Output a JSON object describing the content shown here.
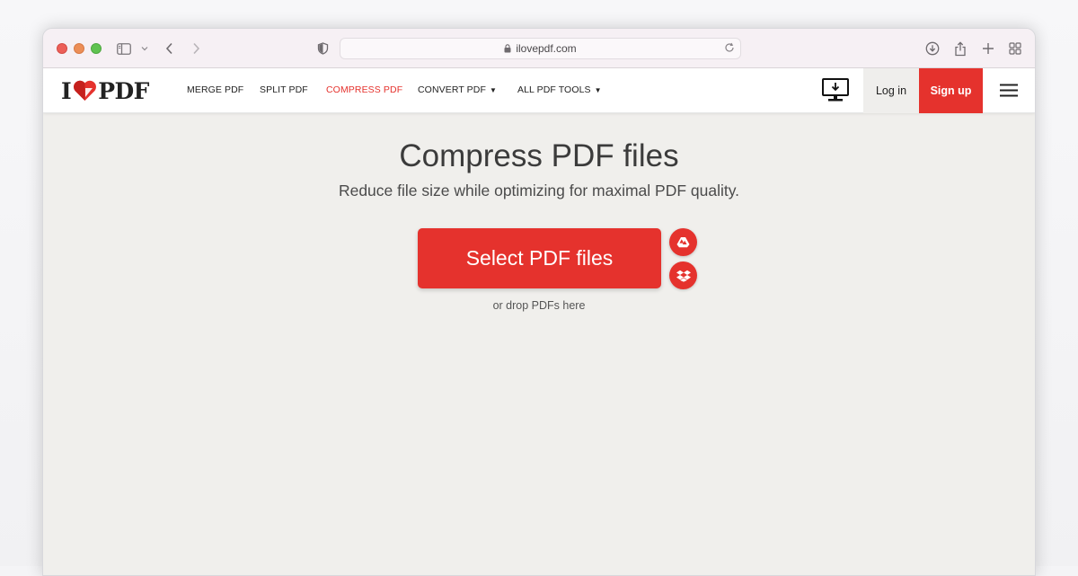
{
  "browser": {
    "address": "ilovepdf.com",
    "icons": [
      "sidebar-icon",
      "chevron-down-icon",
      "back-icon",
      "forward-icon",
      "privacy-shield-icon",
      "lock-icon",
      "reload-icon",
      "download-icon",
      "share-icon",
      "new-tab-icon",
      "tab-overview-icon"
    ]
  },
  "header": {
    "logo": {
      "left": "I",
      "right": "PDF",
      "heart_color": "#e5322d"
    },
    "nav": [
      {
        "label": "MERGE PDF",
        "active": false
      },
      {
        "label": "SPLIT PDF",
        "active": false
      },
      {
        "label": "COMPRESS PDF",
        "active": true
      },
      {
        "label": "CONVERT PDF",
        "active": false,
        "dropdown": true
      },
      {
        "label": "ALL PDF TOOLS",
        "active": false,
        "dropdown": true
      }
    ],
    "login_label": "Log in",
    "signup_label": "Sign up"
  },
  "main": {
    "title": "Compress PDF files",
    "subtitle": "Reduce file size while optimizing for maximal PDF quality.",
    "select_label": "Select PDF files",
    "drop_hint": "or drop PDFs here",
    "cloud_sources": [
      "google-drive-icon",
      "dropbox-icon"
    ]
  },
  "colors": {
    "accent": "#e5322d",
    "page_bg": "#f0efec",
    "text": "#3b3b3b"
  }
}
